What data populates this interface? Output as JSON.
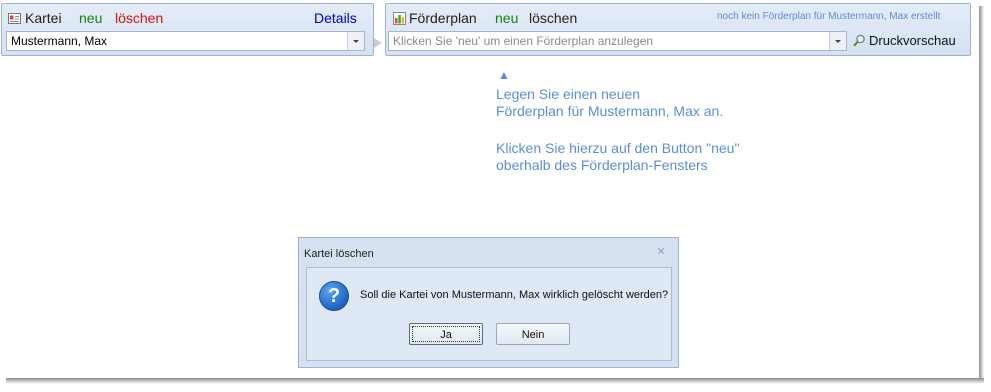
{
  "kartei": {
    "title": "Kartei",
    "new_label": "neu",
    "delete_label": "löschen",
    "details_label": "Details",
    "selected_person": "Mustermann, Max"
  },
  "foerderplan": {
    "title": "Förderplan",
    "new_label": "neu",
    "delete_label": "löschen",
    "status_text": "noch kein Förderplan für Mustermann, Max erstellt",
    "select_placeholder": "Klicken Sie 'neu' um einen Förderplan anzulegen",
    "print_preview_label": "Druckvorschau"
  },
  "hint": {
    "arrow": "▲",
    "line1": "Legen Sie einen neuen",
    "line2": "Förderplan für Mustermann, Max an.",
    "line3": "Klicken Sie hierzu auf den Button \"neu\"",
    "line4": "oberhalb des Förderplan-Fensters"
  },
  "dialog": {
    "title": "Kartei löschen",
    "close_glyph": "✕",
    "question_glyph": "?",
    "message": "Soll die Kartei von Mustermann, Max wirklich gelöscht werden?",
    "yes_label": "Ja",
    "no_label": "Nein"
  },
  "colors": {
    "accent_blue": "#0000cc",
    "new_green": "#118811",
    "delete_red": "#dd1111",
    "hint_blue": "#5b8fd6",
    "panel_bg": "#dfe8f5"
  },
  "icons": {
    "kartei": "card-icon",
    "foerderplan": "bar-chart-icon",
    "druckvorschau": "magnifier-icon",
    "dialog": "question-icon"
  }
}
